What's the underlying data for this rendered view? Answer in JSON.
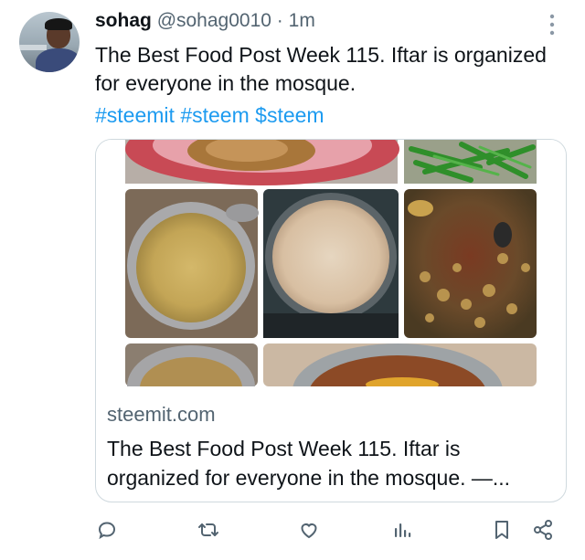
{
  "tweet": {
    "display_name": "sohag",
    "handle": "@sohag0010",
    "separator": "·",
    "timestamp": "1m",
    "text": "The Best Food Post Week 115. Iftar is organized for everyone in the mosque.",
    "hashtags": [
      "#steemit",
      "#steem",
      "$steem"
    ]
  },
  "card": {
    "domain": "steemit.com",
    "title": "The Best Food Post Week 115. Iftar is organized for everyone in the mosque. —..."
  },
  "actions": {
    "reply_icon": "reply-icon",
    "retweet_icon": "retweet-icon",
    "like_icon": "heart-icon",
    "views_icon": "views-icon",
    "bookmark_icon": "bookmark-icon",
    "share_icon": "share-icon"
  },
  "colors": {
    "accent": "#1d9bf0",
    "secondary_text": "#536471",
    "border": "#cfd9de"
  }
}
